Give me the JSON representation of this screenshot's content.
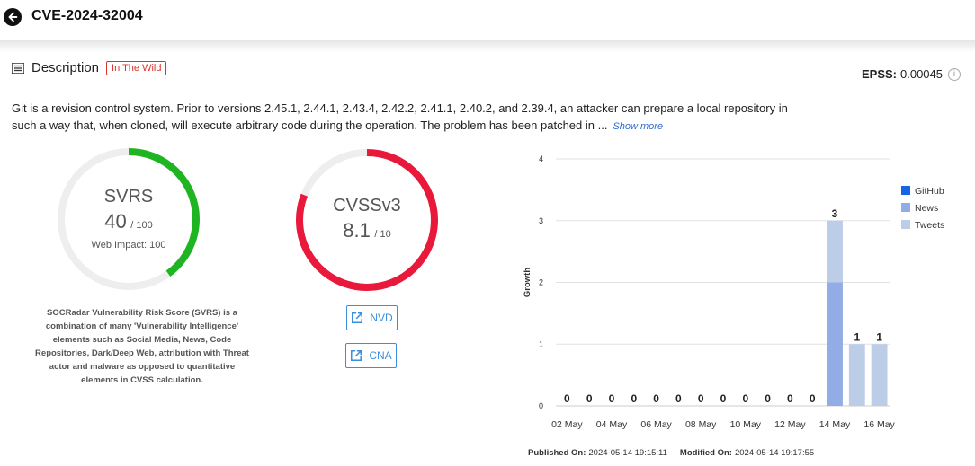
{
  "header": {
    "title": "CVE-2024-32004"
  },
  "description": {
    "heading": "Description",
    "badge": "In The Wild",
    "text": "Git is a revision control system. Prior to versions 2.45.1, 2.44.1, 2.43.4, 2.42.2, 2.41.1, 2.40.2, and 2.39.4, an attacker can prepare a local repository in such a way that, when cloned, will execute arbitrary code during the operation. The problem has been patched in ...",
    "show_more": "Show more"
  },
  "epss": {
    "label": "EPSS:",
    "value": "0.00045"
  },
  "svrs": {
    "name": "SVRS",
    "score": "40",
    "max": "/ 100",
    "score_fraction": 0.4,
    "web_impact": "Web Impact: 100",
    "color": "#1fb522",
    "note": "SOCRadar Vulnerability Risk Score (SVRS) is a combination of many 'Vulnerability Intelligence' elements such as Social Media, News, Code Repositories, Dark/Deep Web, attribution with Threat actor and malware as opposed to quantitative elements in CVSS calculation."
  },
  "cvss": {
    "name": "CVSSv3",
    "score": "8.1",
    "max": "/ 10",
    "score_fraction": 0.81,
    "color": "#e8193a"
  },
  "links": {
    "nvd": "NVD",
    "cna": "CNA"
  },
  "chart_data": {
    "type": "bar",
    "stacked": true,
    "categories": [
      "02 May",
      "03 May",
      "04 May",
      "05 May",
      "06 May",
      "07 May",
      "08 May",
      "09 May",
      "10 May",
      "11 May",
      "12 May",
      "13 May",
      "14 May",
      "15 May",
      "16 May"
    ],
    "x_tick_labels": [
      "02 May",
      "04 May",
      "06 May",
      "08 May",
      "10 May",
      "12 May",
      "14 May",
      "16 May"
    ],
    "series": [
      {
        "name": "GitHub",
        "color": "#1763e6",
        "values": [
          0,
          0,
          0,
          0,
          0,
          0,
          0,
          0,
          0,
          0,
          0,
          0,
          0,
          0,
          0
        ]
      },
      {
        "name": "News",
        "color": "#92ade6",
        "values": [
          0,
          0,
          0,
          0,
          0,
          0,
          0,
          0,
          0,
          0,
          0,
          0,
          2,
          0,
          0
        ]
      },
      {
        "name": "Tweets",
        "color": "#bccde8",
        "values": [
          0,
          0,
          0,
          0,
          0,
          0,
          0,
          0,
          0,
          0,
          0,
          0,
          1,
          1,
          1
        ]
      }
    ],
    "totals": [
      0,
      0,
      0,
      0,
      0,
      0,
      0,
      0,
      0,
      0,
      0,
      0,
      3,
      1,
      1
    ],
    "ylabel": "Growth",
    "ylim": [
      0,
      4
    ],
    "yticks": [
      0,
      1,
      2,
      3,
      4
    ],
    "grid": true,
    "legend": "right"
  },
  "footer": {
    "published_label": "Published On:",
    "published_value": "2024-05-14 19:15:11",
    "modified_label": "Modified On:",
    "modified_value": "2024-05-14 19:17:55"
  }
}
